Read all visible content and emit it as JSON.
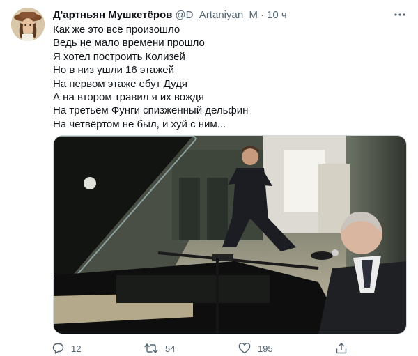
{
  "tweet": {
    "display_name": "Д'артньян Мушкетёров",
    "handle": "@D_Artaniyan_M",
    "separator": "·",
    "time": "10 ч",
    "lines": [
      "Как же это всё произошло",
      "Ведь не мало времени прошло",
      "Я хотел построить Колизей",
      "Но в низ ушли 16 этажей",
      "На первом этаже ебут Дудя",
      "А на втором травил я их вождя",
      "На третьем Фунги спизженный дельфин",
      "На четвёртом не был, и хуй с ним..."
    ],
    "actions": {
      "reply_count": "12",
      "retweet_count": "54",
      "like_count": "195"
    }
  },
  "icons": {
    "more": "more-dots-icon",
    "reply": "reply-bubble-icon",
    "retweet": "retweet-icon",
    "like": "heart-icon",
    "share": "share-icon"
  },
  "colors": {
    "text": "#0f1419",
    "secondary": "#536471",
    "border": "#cfd9de"
  }
}
